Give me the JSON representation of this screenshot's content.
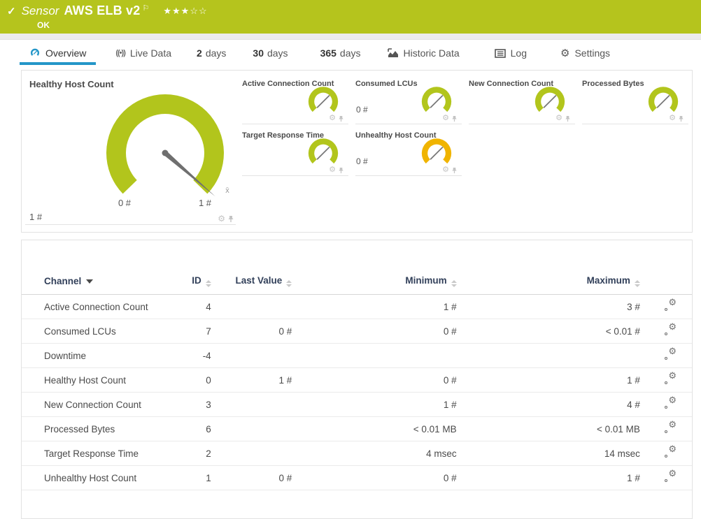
{
  "colors": {
    "header_green": "#b5c41d",
    "gauge_green": "#b2c51c",
    "gauge_amber": "#f0b400",
    "accent_blue": "#2496c8",
    "needle_gray": "#6f6f6f"
  },
  "header": {
    "check_icon": "✓",
    "kind_label": "Sensor",
    "title": "AWS ELB v2",
    "flag_icon": "⚐",
    "stars_filled": "★★★",
    "stars_empty": "☆☆",
    "status": "OK"
  },
  "tabs": {
    "overview": {
      "label": "Overview"
    },
    "live_data": {
      "label": "Live Data",
      "icon": "((•))"
    },
    "days2": {
      "num": "2",
      "label": "days"
    },
    "days30": {
      "num": "30",
      "label": "days"
    },
    "days365": {
      "num": "365",
      "label": "days"
    },
    "historic": {
      "label": "Historic Data"
    },
    "log": {
      "label": "Log"
    },
    "settings": {
      "label": "Settings",
      "icon": "⚙"
    }
  },
  "gauges": {
    "primary": {
      "title": "Healthy Host Count",
      "current_value": "1 #",
      "scale_min": "0 #",
      "scale_max": "1 #",
      "mean_marker": "x̄"
    },
    "small": [
      {
        "title": "Active Connection Count",
        "value": ""
      },
      {
        "title": "Consumed LCUs",
        "value": "0 #"
      },
      {
        "title": "New Connection Count",
        "value": ""
      },
      {
        "title": "Processed Bytes",
        "value": ""
      },
      {
        "title": "Target Response Time",
        "value": ""
      },
      {
        "title": "Unhealthy Host Count",
        "value": "0 #"
      }
    ],
    "icons": {
      "gear": "⚙"
    }
  },
  "table": {
    "columns": {
      "channel": "Channel",
      "id": "ID",
      "last_value": "Last Value",
      "minimum": "Minimum",
      "maximum": "Maximum"
    },
    "rows": [
      {
        "channel": "Active Connection Count",
        "id": "4",
        "last_value": "",
        "minimum": "1 #",
        "maximum": "3 #"
      },
      {
        "channel": "Consumed LCUs",
        "id": "7",
        "last_value": "0 #",
        "minimum": "0 #",
        "maximum": "< 0.01 #"
      },
      {
        "channel": "Downtime",
        "id": "-4",
        "last_value": "",
        "minimum": "",
        "maximum": ""
      },
      {
        "channel": "Healthy Host Count",
        "id": "0",
        "last_value": "1 #",
        "minimum": "0 #",
        "maximum": "1 #"
      },
      {
        "channel": "New Connection Count",
        "id": "3",
        "last_value": "",
        "minimum": "1 #",
        "maximum": "4 #"
      },
      {
        "channel": "Processed Bytes",
        "id": "6",
        "last_value": "",
        "minimum": "< 0.01 MB",
        "maximum": "< 0.01 MB"
      },
      {
        "channel": "Target Response Time",
        "id": "2",
        "last_value": "",
        "minimum": "4 msec",
        "maximum": "14 msec"
      },
      {
        "channel": "Unhealthy Host Count",
        "id": "1",
        "last_value": "0 #",
        "minimum": "0 #",
        "maximum": "1 #"
      }
    ]
  }
}
